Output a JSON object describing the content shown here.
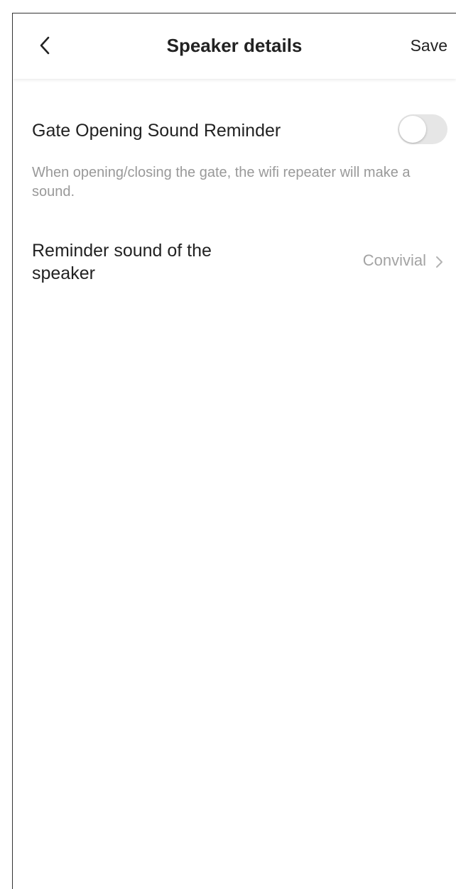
{
  "header": {
    "title": "Speaker details",
    "save_label": "Save",
    "back_icon": "chevron-left-icon"
  },
  "settings": {
    "gate_sound": {
      "label": "Gate Opening Sound Reminder",
      "enabled": false,
      "hint": "When opening/closing the gate, the wifi repeater will make a sound."
    },
    "reminder_sound": {
      "label": "Reminder sound of the speaker",
      "value": "Convivial",
      "icon": "chevron-right-icon"
    }
  },
  "colors": {
    "text_primary": "#222222",
    "text_secondary": "#999999",
    "toggle_off": "#e6e6e6"
  }
}
